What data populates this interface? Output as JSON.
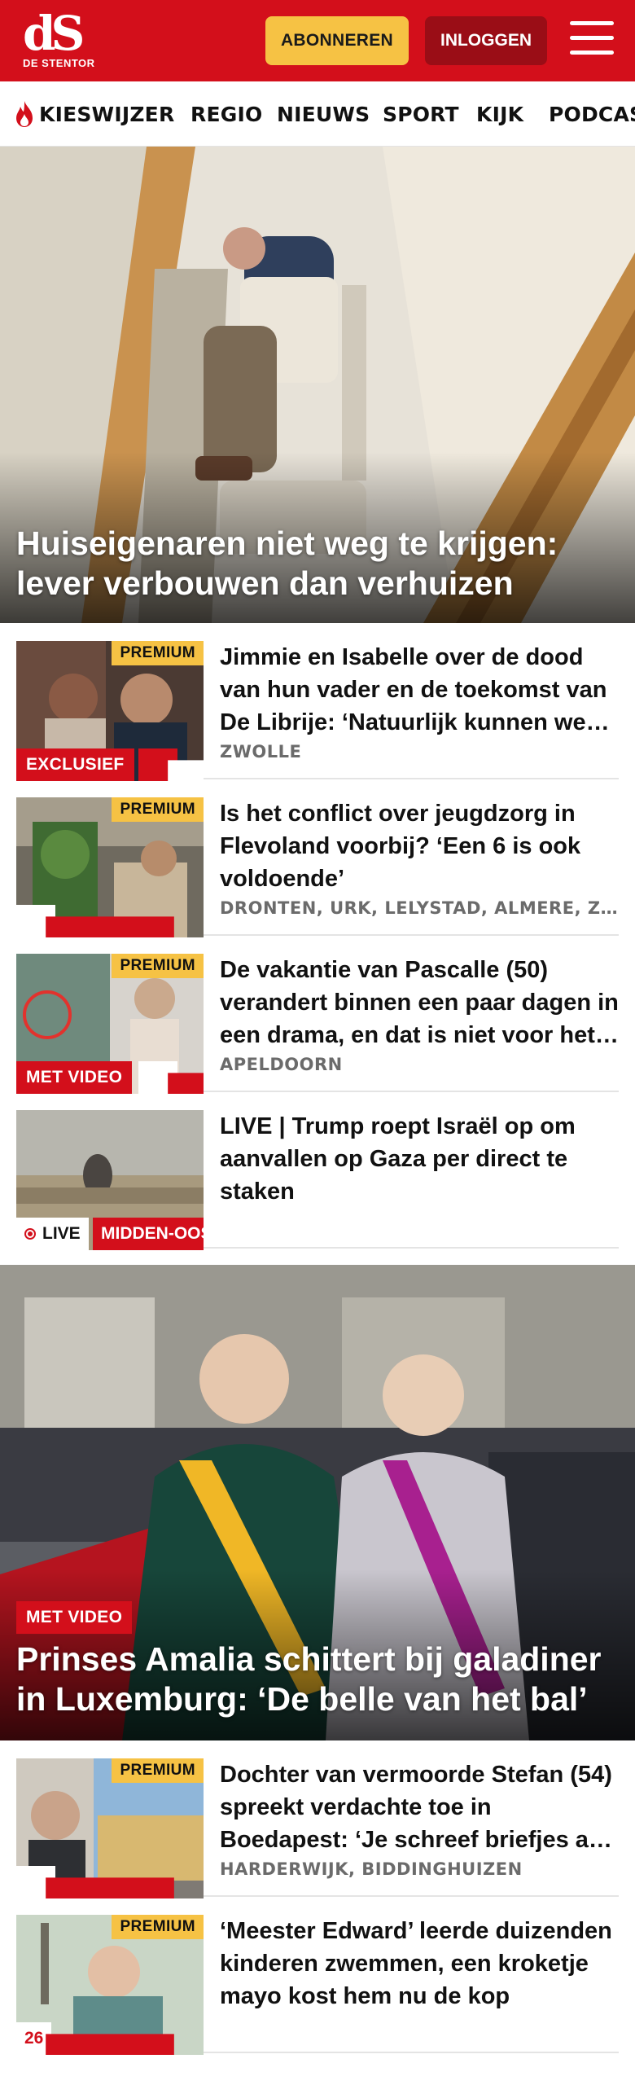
{
  "header": {
    "logo_mark": "dS",
    "logo_sub": "DE STENTOR",
    "subscribe_label": "ABONNEREN",
    "login_label": "INLOGGEN",
    "menu_icon": "hamburger-icon",
    "brand_color": "#d30f1b",
    "subscribe_color": "#f6c244"
  },
  "nav": {
    "items": [
      {
        "label": "KIESWIJZER",
        "icon": "flame-icon"
      },
      {
        "label": "REGIO"
      },
      {
        "label": "NIEUWS"
      },
      {
        "label": "SPORT"
      },
      {
        "label": "KIJK"
      },
      {
        "label": "PODCAST"
      }
    ]
  },
  "hero1": {
    "title": "Huiseigenaren niet weg te krijgen: lever verbouwen dan verhuizen"
  },
  "articles1": [
    {
      "premium": "PREMIUM",
      "badge": "EXCLUSIEF",
      "comment_icon": "comment-icon",
      "headline": "Jimmie en Isabelle over de dood van hun vader en de toekomst van De Librije: ‘Natuurlijk kunnen we dit’",
      "location": "ZWOLLE"
    },
    {
      "premium": "PREMIUM",
      "comment_icon": "comment-icon",
      "headline": "Is het conflict over jeugdzorg in Flevoland voorbij? ‘Een 6 is ook voldoende’",
      "location": "DRONTEN, URK, LELYSTAD, ALMERE, ZEEWOLDE"
    },
    {
      "premium": "PREMIUM",
      "badge": "MET VIDEO",
      "comment_icon": "comment-icon",
      "headline": "De vakantie van Pascalle (50) verandert binnen een paar dagen in een drama, en dat is niet voor het eerst",
      "location": "APELDOORN"
    },
    {
      "live_label": "LIVE",
      "region": "MIDDEN-OOSTEN",
      "headline": "LIVE | Trump roept Israël op om aanvallen op Gaza per direct te staken"
    }
  ],
  "hero2": {
    "badge": "MET VIDEO",
    "title": "Prinses Amalia schittert bij galadiner in Luxemburg: ‘De belle van het bal’"
  },
  "articles2": [
    {
      "premium": "PREMIUM",
      "comment_icon": "comment-icon",
      "headline": "Dochter van vermoorde Stefan (54) spreekt verdachte toe in Boedapest: ‘Je schreef briefjes aan mijn vader’",
      "location": "HARDERWIJK, BIDDINGHUIZEN"
    },
    {
      "premium": "PREMIUM",
      "comment_count": "26",
      "headline": "‘Meester Edward’ leerde duizenden kinderen zwemmen, een kroketje mayo kost hem nu de kop"
    }
  ]
}
